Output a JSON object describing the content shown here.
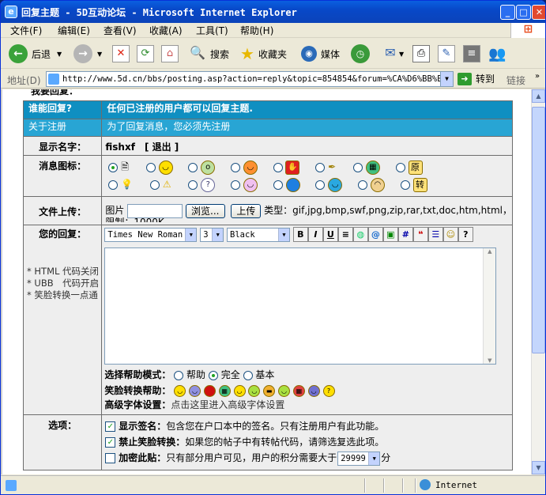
{
  "window": {
    "title": "回复主题 - 5D互动论坛 - Microsoft Internet Explorer"
  },
  "menu": {
    "items": [
      "文件(F)",
      "编辑(E)",
      "查看(V)",
      "收藏(A)",
      "工具(T)",
      "帮助(H)"
    ]
  },
  "toolbar": {
    "back": "后退",
    "search": "搜索",
    "favorites": "收藏夹",
    "media": "媒体"
  },
  "address": {
    "label": "地址(D)",
    "url": "http://www.5d.cn/bbs/posting.asp?action=reply&topic=854854&forum=%CA%D6%BB%E6%B",
    "go": "转到",
    "links": "链接"
  },
  "form": {
    "partial_heading": "我要回复：",
    "who_label": "谁能回复?",
    "who_value": "任何已注册的用户都可以回复主题.",
    "reg_label": "关于注册",
    "reg_value": "为了回复消息，您必须先注册",
    "name_label": "显示名字：",
    "name_value": "fishxf",
    "logout": "[ 退出 ]",
    "icon_label": "消息图标：",
    "upload_label": "文件上传：",
    "upload_pic": "图片",
    "browse": "浏览...",
    "upload_btn": "上传",
    "upload_types": "类型：gif,jpg,bmp,swf,png,zip,rar,txt,doc,htm,html，",
    "upload_limit": "限制：1000K",
    "reply_label": "您的回复：",
    "notes": [
      "* HTML 代码关闭",
      "* UBB　代码开启",
      "* 笑脸转换一点通"
    ],
    "font_name": "Times New Roman",
    "font_size": "3",
    "font_color": "Black",
    "help_mode_label": "选择帮助模式：",
    "help_modes": [
      "帮助",
      "完全",
      "基本"
    ],
    "smiley_label": "笑脸转换帮助：",
    "adv_font_label": "高级字体设置：",
    "adv_font_link": "点击这里进入高级字体设置",
    "options_label": "选项：",
    "options": [
      {
        "title": "显示签名：",
        "desc": "包含您在户口本中的签名。只有注册用户有此功能。"
      },
      {
        "title": "禁止笑脸转换：",
        "desc": "如果您的帖子中有转帖代码，请筛选复选此项。"
      },
      {
        "title": "加密此贴：",
        "desc": "只有部分用户可见，用户的积分需要大于"
      }
    ],
    "points_value": "29999",
    "points_unit": "分"
  },
  "status": {
    "zone": "Internet"
  }
}
